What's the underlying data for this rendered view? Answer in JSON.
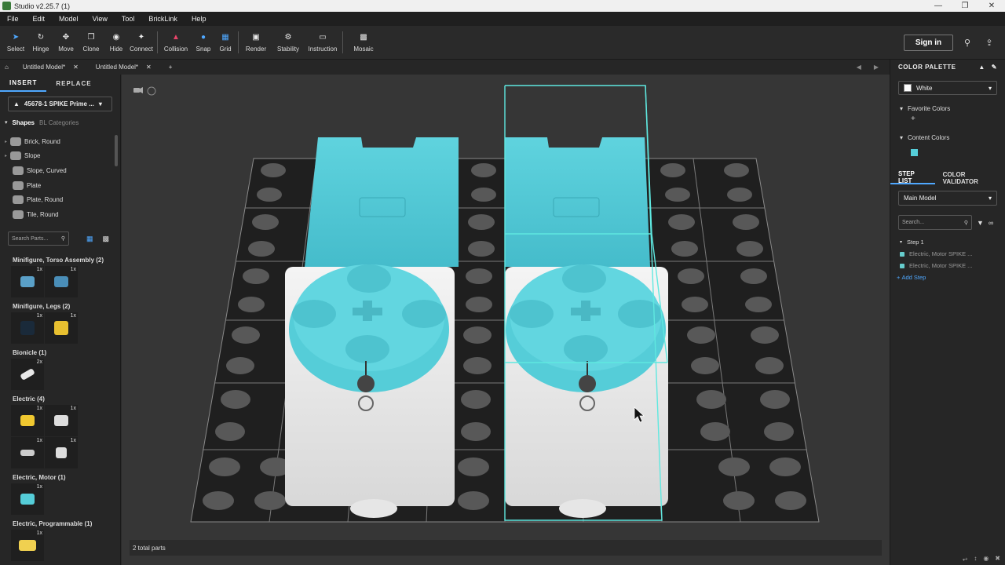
{
  "window": {
    "title": "Studio v2.25.7 (1)"
  },
  "menu": [
    "File",
    "Edit",
    "Model",
    "View",
    "Tool",
    "BrickLink",
    "Help"
  ],
  "toolbar": {
    "tools": [
      "Select",
      "Hinge",
      "Move",
      "Clone",
      "Hide",
      "Connect",
      "Collision",
      "Snap",
      "Grid",
      "Render",
      "Stability",
      "Instruction",
      "Mosaic"
    ],
    "signin": "Sign in"
  },
  "tabs": [
    "Untitled Model*",
    "Untitled Model*"
  ],
  "left": {
    "tabs": [
      "INSERT",
      "REPLACE"
    ],
    "set": "45678-1 SPIKE Prime ...",
    "cat_tabs": [
      "Shapes",
      "BL Categories"
    ],
    "categories": [
      "Brick, Round",
      "Slope",
      "Slope, Curved",
      "Plate",
      "Plate, Round",
      "Tile, Round"
    ],
    "search_placeholder": "Search Parts...",
    "groups": [
      {
        "title": "Minifigure, Torso Assembly (2)",
        "counts": [
          "1x",
          "1x"
        ]
      },
      {
        "title": "Minifigure, Legs (2)",
        "counts": [
          "1x",
          "1x"
        ]
      },
      {
        "title": "Bionicle (1)",
        "counts": [
          "2x"
        ]
      },
      {
        "title": "Electric (4)",
        "counts": [
          "1x",
          "1x",
          "1x",
          "1x"
        ]
      },
      {
        "title": "Electric, Motor (1)",
        "counts": [
          "1x"
        ]
      },
      {
        "title": "Electric, Programmable (1)",
        "counts": [
          "1x"
        ]
      }
    ]
  },
  "status": "2 total parts",
  "right": {
    "palette_title": "COLOR PALETTE",
    "color": "White",
    "favorite": "Favorite Colors",
    "content": "Content Colors",
    "tabs": [
      "STEP LIST",
      "COLOR VALIDATOR"
    ],
    "model": "Main Model",
    "search_placeholder": "Search...",
    "step": "Step 1",
    "items": [
      "Electric, Motor SPIKE ...",
      "Electric, Motor SPIKE ..."
    ],
    "add_step": "Add Step"
  },
  "colors": {
    "accent": "#4fa8ff",
    "part_cyan": "#55cdd8",
    "selection": "#5fe8e0"
  }
}
